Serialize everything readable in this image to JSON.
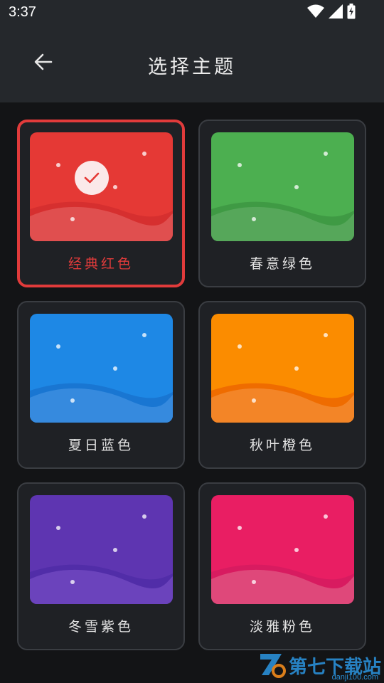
{
  "status_bar": {
    "time": "3:37",
    "icons": [
      "wifi-icon",
      "cellular-signal-icon",
      "battery-charging-icon"
    ]
  },
  "app_bar": {
    "title": "选择主题",
    "back_icon": "arrow-left-icon"
  },
  "themes": [
    {
      "name": "经典红色",
      "selected": true,
      "color_top": "#e53935",
      "color_mid": "#d62f2f",
      "color_low": "#e25555"
    },
    {
      "name": "春意绿色",
      "selected": false,
      "color_top": "#4caf50",
      "color_mid": "#3f9a44",
      "color_low": "#5aa95e"
    },
    {
      "name": "夏日蓝色",
      "selected": false,
      "color_top": "#1e88e5",
      "color_mid": "#1976d2",
      "color_low": "#3c8ee0"
    },
    {
      "name": "秋叶橙色",
      "selected": false,
      "color_top": "#fb8c00",
      "color_mid": "#ef6c00",
      "color_low": "#f38a2e"
    },
    {
      "name": "冬雪紫色",
      "selected": false,
      "color_top": "#5e35b1",
      "color_mid": "#512da8",
      "color_low": "#7048c0"
    },
    {
      "name": "淡雅粉色",
      "selected": false,
      "color_top": "#e91e63",
      "color_mid": "#d81b60",
      "color_low": "#e0507f"
    }
  ],
  "watermark": {
    "text": "第七下载站",
    "url": "danji100.com"
  }
}
